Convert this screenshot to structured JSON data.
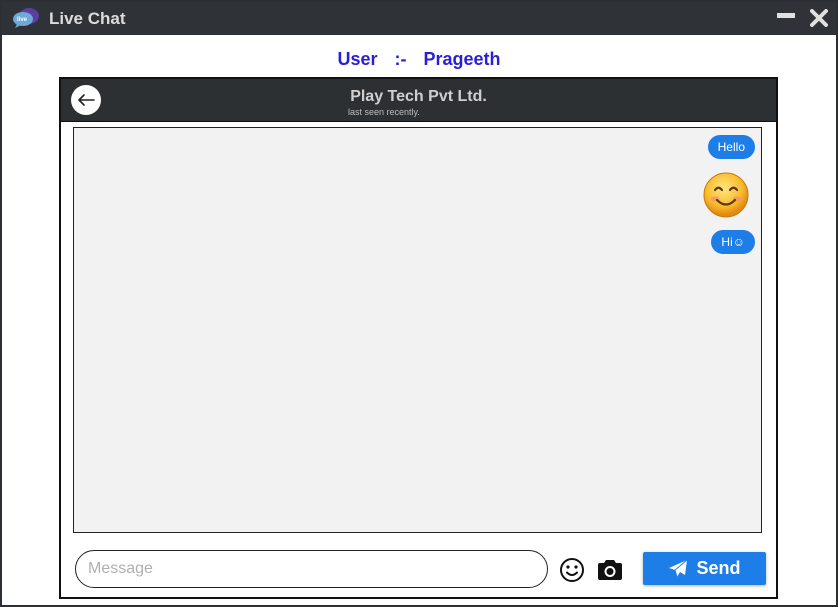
{
  "window": {
    "title": "Live Chat",
    "app_icon": "chat-bubbles-icon",
    "controls": {
      "minimize_icon": "minimize-icon",
      "close_icon": "close-icon"
    }
  },
  "user": {
    "label": "User",
    "separator": ":-",
    "name": "Prageeth"
  },
  "chat": {
    "contact_name": "Play Tech Pvt Ltd.",
    "status": "last seen recently.",
    "back_icon": "back-arrow-icon",
    "messages": [
      {
        "type": "text",
        "text": "Hello",
        "from": "me"
      },
      {
        "type": "emoji",
        "icon": "smiling-face-emoji",
        "from": "me"
      },
      {
        "type": "text",
        "text": "Hi☺",
        "from": "me"
      }
    ]
  },
  "composer": {
    "placeholder": "Message",
    "value": "",
    "emoji_icon": "smiley-icon",
    "camera_icon": "camera-icon",
    "send_label": "Send",
    "send_icon": "paper-plane-icon"
  },
  "colors": {
    "titlebar": "#2f3236",
    "accent": "#1e7ee8",
    "user_text": "#2a1fd6",
    "messages_bg": "#f2f2f2"
  }
}
